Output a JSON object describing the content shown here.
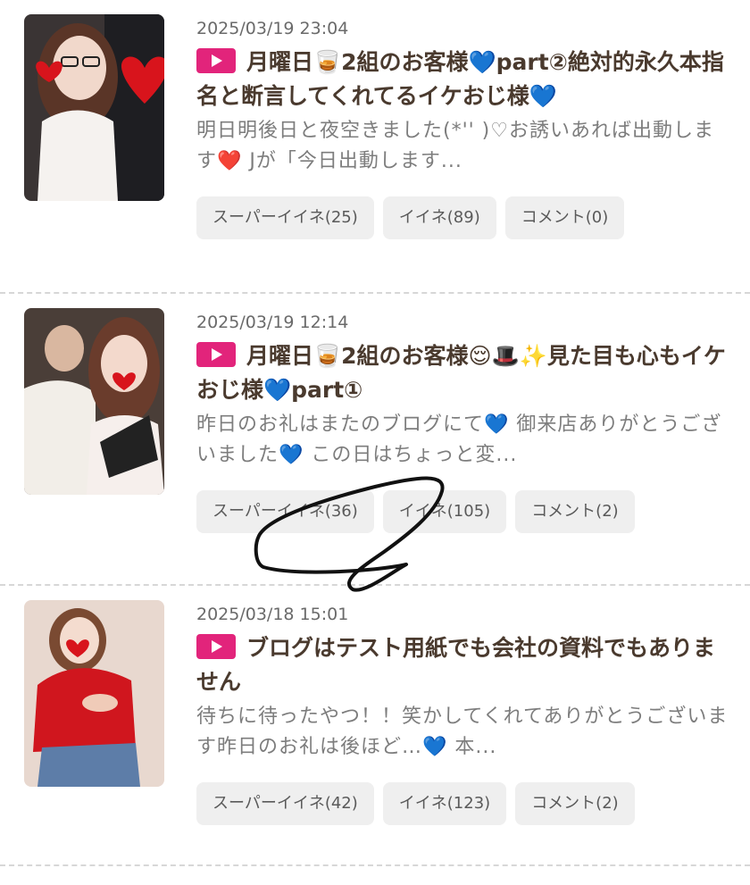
{
  "posts": [
    {
      "date": "2025/03/19 23:04",
      "title": "月曜日🥃2組のお客様💙part②絶対的永久本指名と断言してくれてるイケおじ様💙",
      "excerpt": "明日明後日と夜空きました(*'' )♡お誘いあれば出動します❤️ Jが「今日出動します...",
      "buttons": [
        "スーパーイイネ(25)",
        "イイネ(89)",
        "コメント(0)"
      ]
    },
    {
      "date": "2025/03/19 12:14",
      "title": "月曜日🥃2組のお客様😌🎩✨見た目も心もイケおじ様💙part①",
      "excerpt": "昨日のお礼はまたのブログにて💙 御来店ありがとうございました💙 この日はちょっと変...",
      "buttons": [
        "スーパーイイネ(36)",
        "イイネ(105)",
        "コメント(2)"
      ]
    },
    {
      "date": "2025/03/18 15:01",
      "title": "ブログはテスト用紙でも会社の資料でもありません",
      "excerpt": "待ちに待ったやつ！！笑かしてくれてありがとうございます昨日のお礼は後ほど…💙 本...",
      "buttons": [
        "スーパーイイネ(42)",
        "イイネ(123)",
        "コメント(2)"
      ]
    }
  ],
  "colors": {
    "accent": "#e2247b",
    "button_bg": "#efefef",
    "divider": "#d7d7d7"
  }
}
